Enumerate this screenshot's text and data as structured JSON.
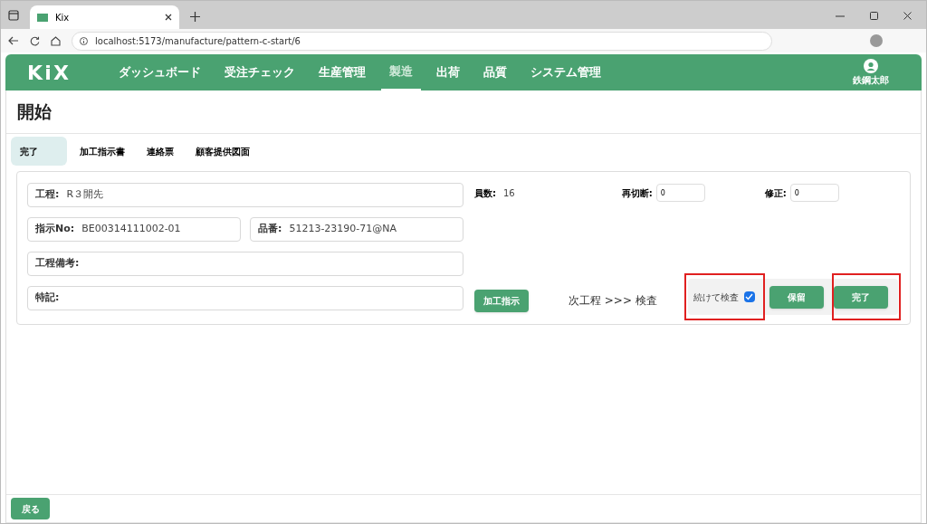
{
  "browser": {
    "tab_title": "Kix",
    "url": "localhost:5173/manufacture/pattern-c-start/6"
  },
  "header": {
    "logo": "KiX",
    "nav": [
      {
        "label": "ダッシュボード",
        "selected": false
      },
      {
        "label": "受注チェック",
        "selected": false
      },
      {
        "label": "生産管理",
        "selected": false
      },
      {
        "label": "製造",
        "selected": true
      },
      {
        "label": "出荷",
        "selected": false
      },
      {
        "label": "品質",
        "selected": false
      },
      {
        "label": "システム管理",
        "selected": false
      }
    ],
    "user": "鉄鋼太郎"
  },
  "page_title": "開始",
  "tabs": [
    {
      "label": "完了",
      "selected": true
    },
    {
      "label": "加工指示書",
      "selected": false
    },
    {
      "label": "連絡票",
      "selected": false
    },
    {
      "label": "顧客提供図面",
      "selected": false
    }
  ],
  "form": {
    "process": {
      "label": "工程:",
      "value": "R３開先"
    },
    "order_no": {
      "label": "指示No:",
      "value": "BE00314111002-01"
    },
    "part_no": {
      "label": "品番:",
      "value": "51213-23190-71@NA"
    },
    "process_note": {
      "label": "工程備考:"
    },
    "special_note": {
      "label": "特記:"
    },
    "staff": {
      "label": "員数:",
      "value": "16"
    },
    "recut": {
      "label": "再切断:",
      "value": "0"
    },
    "fix": {
      "label": "修正:",
      "value": "0"
    },
    "instruction_button": "加工指示",
    "next_process": "次工程 >>> 検査",
    "continue_check": {
      "label": "続けて検査",
      "checked": true
    },
    "hold_button": "保留",
    "complete_button": "完了"
  },
  "back_button": "戻る"
}
